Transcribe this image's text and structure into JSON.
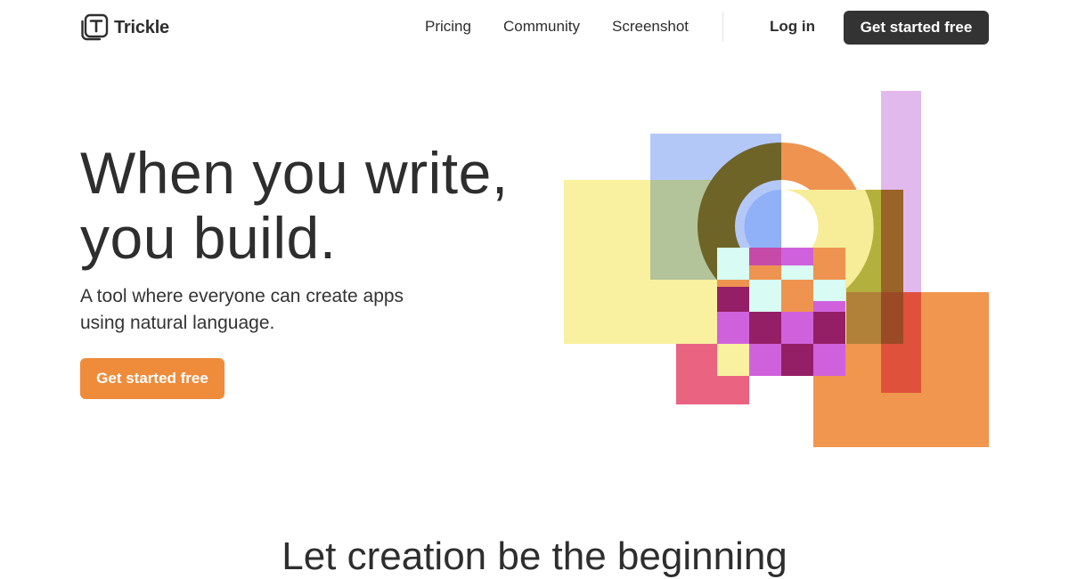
{
  "nav": {
    "logo_text": "Trickle",
    "links": [
      "Pricing",
      "Community",
      "Screenshot"
    ],
    "login": "Log in",
    "cta": "Get started free"
  },
  "hero": {
    "headline_line1": "When you write,",
    "headline_line2": "you build.",
    "subtext_line1": "A tool where everyone can create apps",
    "subtext_line2": "using natural language.",
    "cta": "Get started free"
  },
  "next_section": {
    "title": "Let creation be the beginning"
  },
  "colors": {
    "brand_dark": "#333333",
    "accent_orange": "#ee8c3c",
    "art_yellow": "#f9f0a0",
    "art_blue": "#b4c8f8",
    "art_lavender": "#e2b9ec",
    "art_magenta": "#cf62dc",
    "art_pink": "#ea6482"
  },
  "icons": {
    "logo": "trickle-logo-icon"
  }
}
